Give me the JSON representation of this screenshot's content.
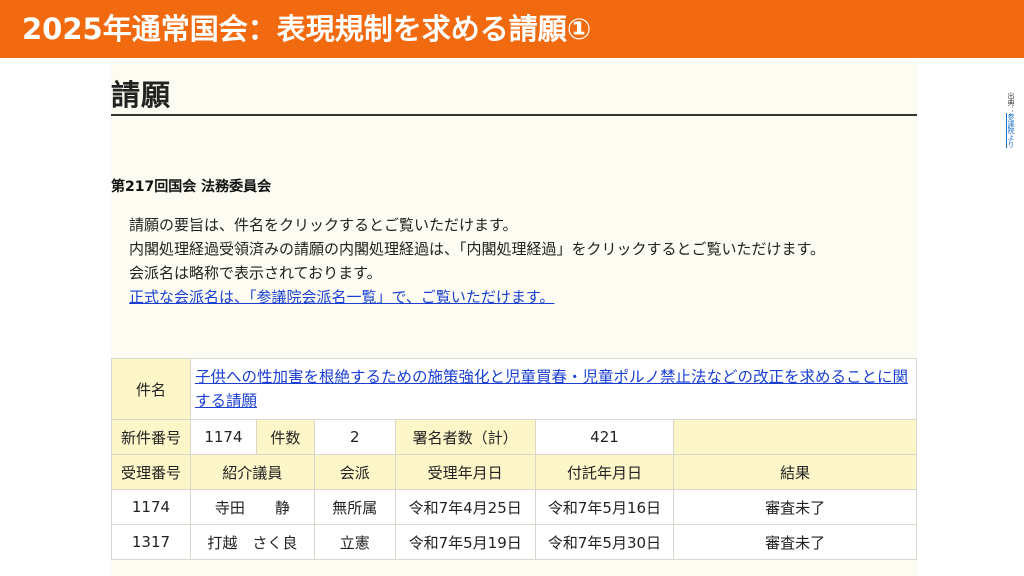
{
  "banner": {
    "title": "2025年通常国会：表現規制を求める請願①"
  },
  "source": {
    "label": "出典：",
    "link": "参議院より"
  },
  "page": {
    "heading": "請願",
    "committee": "第217回国会 法務委員会",
    "notes": [
      "請願の要旨は、件名をクリックするとご覧いただけます。",
      "内閣処理経過受領済みの請願の内閣処理経過は、「内閣処理経過」をクリックするとご覧いただけます。",
      "会派名は略称で表示されております。"
    ],
    "notes_link": "正式な会派名は、「参議院会派名一覧」で、ご覧いただけます。"
  },
  "table": {
    "subject_label": "件名",
    "subject": "子供への性加害を根絶するための施策強化と児童買春・児童ポルノ禁止法などの改正を求めることに関する請願",
    "new_no_label": "新件番号",
    "new_no": "1174",
    "count_label": "件数",
    "count": "2",
    "signers_label": "署名者数（計）",
    "signers": "421",
    "columns": [
      "受理番号",
      "紹介議員",
      "会派",
      "受理年月日",
      "付託年月日",
      "結果"
    ],
    "rows": [
      [
        "1174",
        "寺田　　静",
        "無所属",
        "令和7年4月25日",
        "令和7年5月16日",
        "審査未了"
      ],
      [
        "1317",
        "打越　さく良",
        "立憲",
        "令和7年5月19日",
        "令和7年5月30日",
        "審査未了"
      ]
    ]
  }
}
